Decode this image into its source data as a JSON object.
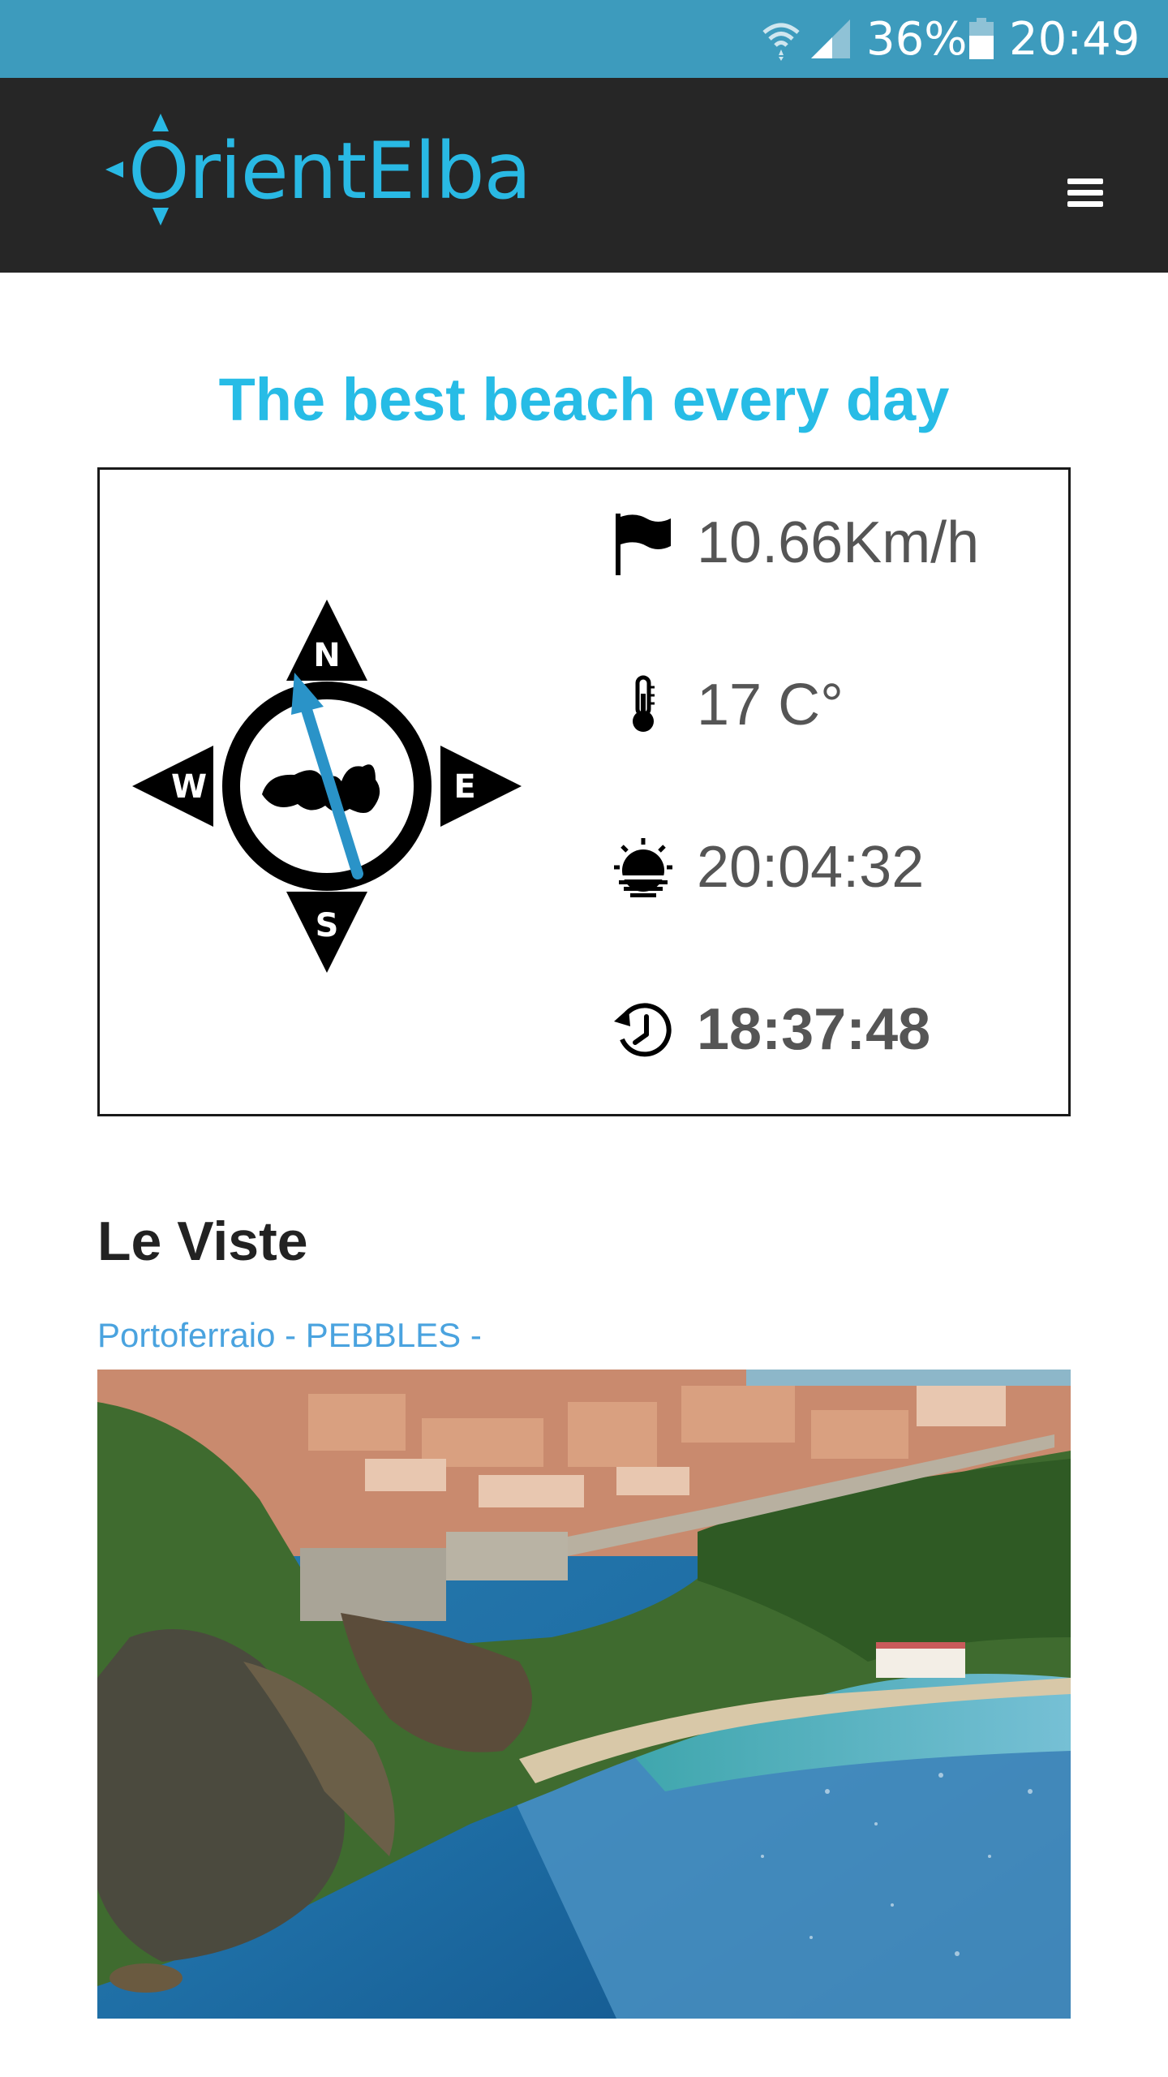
{
  "status_bar": {
    "battery_percent": "36%",
    "time": "20:49",
    "icons": [
      "wifi-icon",
      "signal-icon",
      "battery-icon"
    ]
  },
  "header": {
    "logo_text": "OrientElba",
    "menu_icon": "hamburger-menu-icon"
  },
  "headline": "The best beach every day",
  "weather": {
    "compass_letters": {
      "north": "N",
      "south": "S",
      "east": "E",
      "west": "W"
    },
    "wind_speed": "10.66Km/h",
    "temperature": "17 C°",
    "sunset": "20:04:32",
    "time_left": "18:37:48",
    "icons": [
      "flag-icon",
      "thermometer-icon",
      "sunset-icon",
      "clock-history-icon"
    ]
  },
  "beach": {
    "name": "Le Viste",
    "location": "Portoferraio - PEBBLES -"
  },
  "colors": {
    "status_bar": "#3d9bbd",
    "header": "#262626",
    "accent": "#27bce6",
    "link": "#4aa3df",
    "text_grey": "#555555"
  }
}
